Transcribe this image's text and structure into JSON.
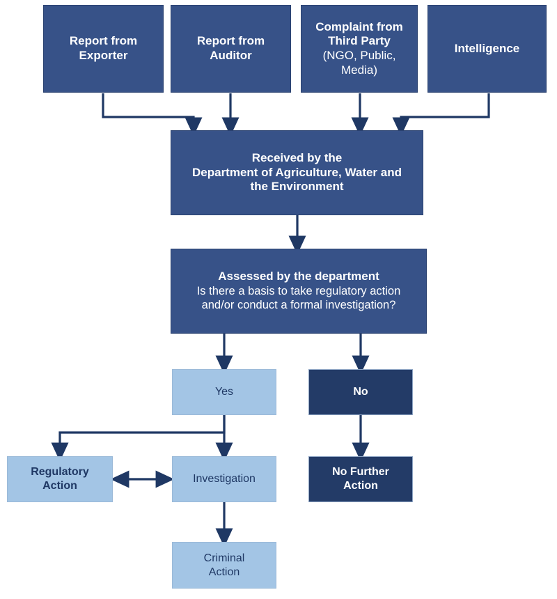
{
  "diagram": {
    "title": "Compliance referral and assessment flowchart",
    "colors": {
      "medium_blue": "#375288",
      "light_blue": "#a3c5e5",
      "dark_navy": "#233b67",
      "connector": "#1f3864",
      "background": "#ffffff"
    }
  },
  "sources": [
    {
      "id": "exporter",
      "line1": "Report from",
      "line2": "Exporter"
    },
    {
      "id": "auditor",
      "line1": "Report from",
      "line2": "Auditor"
    },
    {
      "id": "third_party",
      "line1": "Complaint from",
      "line2": "Third Party",
      "line3": "(NGO, Public,",
      "line4": "Media)"
    },
    {
      "id": "intelligence",
      "line1": "Intelligence"
    }
  ],
  "received": {
    "line1": "Received by the",
    "line2": "Department of Agriculture, Water and",
    "line3": "the Environment"
  },
  "assessed": {
    "heading": "Assessed by the department",
    "question_line1": "Is there a basis to take regulatory action",
    "question_line2": "and/or conduct a formal investigation?"
  },
  "decision": {
    "yes": "Yes",
    "no": "No"
  },
  "outcomes": {
    "regulatory_action_line1": "Regulatory",
    "regulatory_action_line2": "Action",
    "investigation": "Investigation",
    "no_further_action_line1": "No Further",
    "no_further_action_line2": "Action",
    "criminal_action_line1": "Criminal",
    "criminal_action_line2": "Action"
  }
}
